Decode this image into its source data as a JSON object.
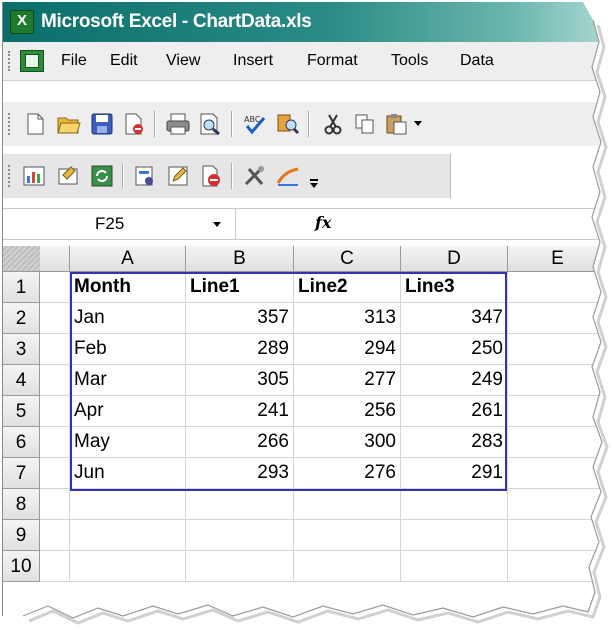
{
  "window": {
    "title": "Microsoft Excel - ChartData.xls",
    "app_icon": "X"
  },
  "menu": [
    "File",
    "Edit",
    "View",
    "Insert",
    "Format",
    "Tools",
    "Data"
  ],
  "toolbar_standard": [
    "new-icon",
    "open-icon",
    "save-icon",
    "permission-icon",
    "print-icon",
    "print-preview-icon",
    "spelling-icon",
    "research-icon",
    "cut-icon",
    "copy-icon",
    "paste-icon"
  ],
  "toolbar_extra": [
    "insert-chart-icon",
    "properties-icon",
    "refresh-icon",
    "edit-query-icon",
    "edit-icon",
    "delete-icon",
    "tools-icon",
    "drawing-icon"
  ],
  "formula_bar": {
    "name_box": "F25",
    "fx_label": "fx",
    "content": ""
  },
  "sheet": {
    "columns": [
      "A",
      "B",
      "C",
      "D",
      "E"
    ],
    "rows": [
      "1",
      "2",
      "3",
      "4",
      "5",
      "6",
      "7",
      "8",
      "9",
      "10"
    ],
    "cells": [
      [
        "Month",
        "Line1",
        "Line2",
        "Line3"
      ],
      [
        "Jan",
        "357",
        "313",
        "347"
      ],
      [
        "Feb",
        "289",
        "294",
        "250"
      ],
      [
        "Mar",
        "305",
        "277",
        "249"
      ],
      [
        "Apr",
        "241",
        "256",
        "261"
      ],
      [
        "May",
        "266",
        "300",
        "283"
      ],
      [
        "Jun",
        "293",
        "276",
        "291"
      ]
    ]
  },
  "colors": {
    "title_bar": "#0a6e6a",
    "selection_border": "#3232b4",
    "header_bg": "#e6e6e6"
  }
}
